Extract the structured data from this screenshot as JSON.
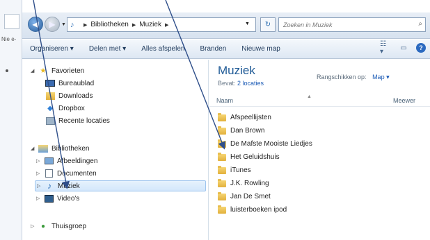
{
  "left_window": {
    "label": "Nie e-"
  },
  "address_bar": {
    "crumbs": [
      "Bibliotheken",
      "Muziek"
    ],
    "search_placeholder": "Zoeken in Muziek"
  },
  "toolbar": {
    "organize": "Organiseren ▾",
    "share": "Delen met ▾",
    "play_all": "Alles afspelen",
    "burn": "Branden",
    "new_folder": "Nieuwe map"
  },
  "nav": {
    "favorites_header": "Favorieten",
    "favorites": [
      "Bureaublad",
      "Downloads",
      "Dropbox",
      "Recente locaties"
    ],
    "libraries_header": "Bibliotheken",
    "libraries": [
      "Afbeeldingen",
      "Documenten",
      "Muziek",
      "Video's"
    ],
    "homegroup": "Thuisgroep"
  },
  "content": {
    "title": "Muziek",
    "subtitle_prefix": "Bevat:",
    "subtitle_link": "2 locaties",
    "arrange_label": "Rangschikken op:",
    "arrange_value": "Map ▾",
    "col_name": "Naam",
    "col_other": "Meewer",
    "items": [
      "Afspeellijsten",
      "Dan Brown",
      "De Mafste Mooiste Liedjes",
      "Het Geluidshuis",
      "iTunes",
      "J.K. Rowling",
      "Jan De Smet",
      "luisterboeken ipod"
    ]
  },
  "colors": {
    "accent": "#1f5a96",
    "annotation_arrow": "#2f4f8a",
    "folder": "#e8be4f"
  }
}
